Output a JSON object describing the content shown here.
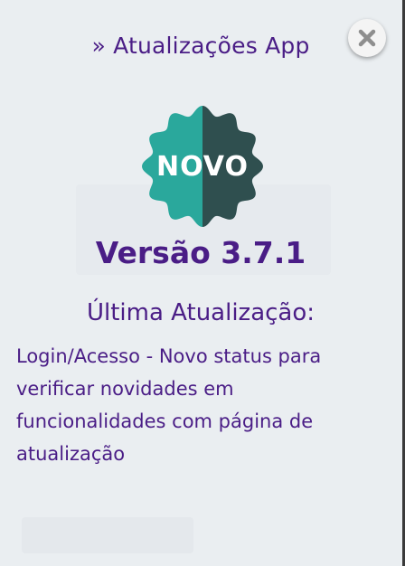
{
  "header": {
    "title": "» Atualizações App"
  },
  "close_button": {
    "icon": "close-icon"
  },
  "badge": {
    "text": "NOVO",
    "color_left": "#2aa89c",
    "color_right": "#2f4f4f"
  },
  "release": {
    "version": "Versão 3.7.1",
    "last_update_label": "Última Atualização:",
    "description": "Login/Acesso - Novo status para verificar novidades em funcionalidades com página de atualização"
  },
  "colors": {
    "text": "#4a1d86",
    "background": "#eaeef1"
  }
}
